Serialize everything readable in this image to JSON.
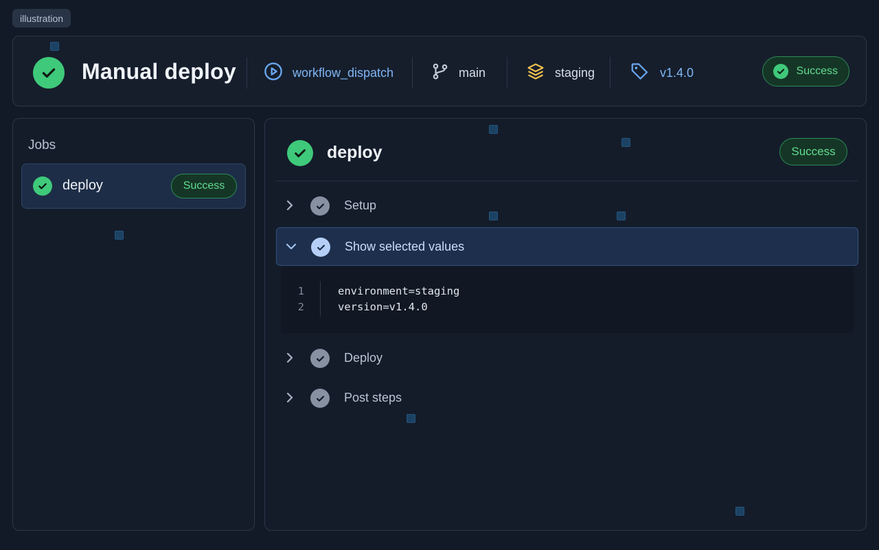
{
  "tag": "illustration",
  "header": {
    "title": "Manual deploy",
    "trigger": "workflow_dispatch",
    "branch": "main",
    "environment": "staging",
    "version": "v1.4.0",
    "status": "Success"
  },
  "sidebar": {
    "heading": "Jobs",
    "jobs": [
      {
        "name": "deploy",
        "status": "Success"
      }
    ]
  },
  "main": {
    "job_title": "deploy",
    "status": "Success",
    "steps": [
      {
        "label": "Setup",
        "expanded": false
      },
      {
        "label": "Show selected values",
        "expanded": true
      },
      {
        "label": "Deploy",
        "expanded": false
      },
      {
        "label": "Post steps",
        "expanded": false
      }
    ],
    "log": [
      {
        "n": "1",
        "text": "environment=staging"
      },
      {
        "n": "2",
        "text": "version=v1.4.0"
      }
    ]
  },
  "colors": {
    "background": "#131a27",
    "success": "#3fc97a",
    "success_text": "#62dc91",
    "accent_blue": "#6aa7f0",
    "accent_yellow": "#f2c14e"
  }
}
